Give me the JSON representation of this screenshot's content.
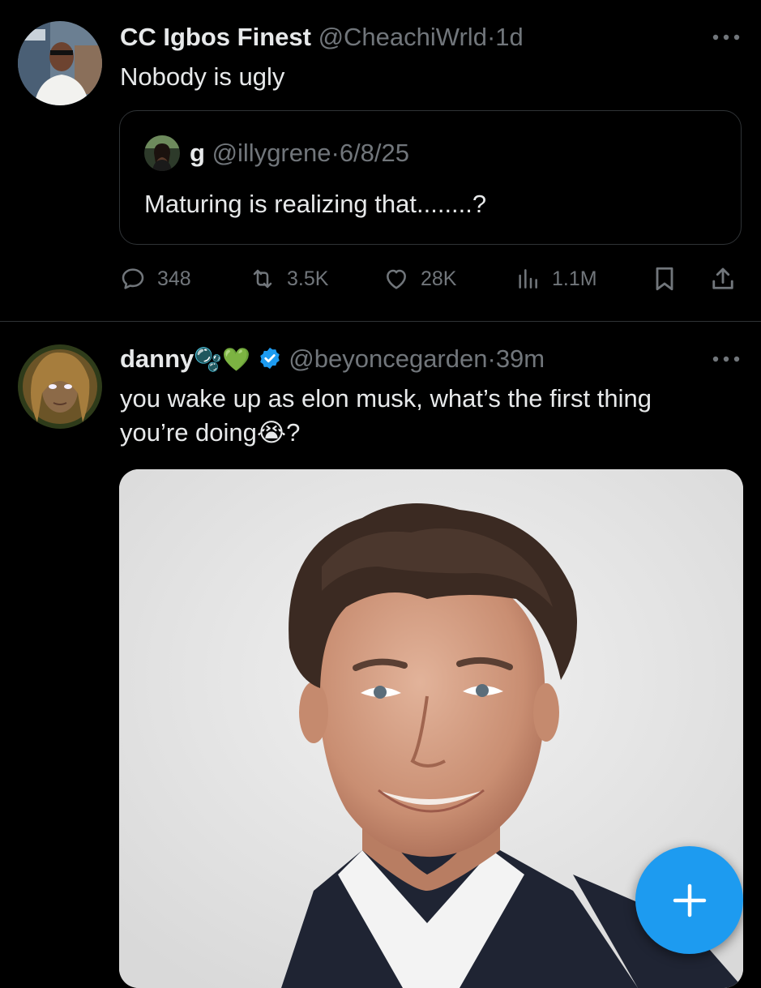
{
  "tweets": [
    {
      "display_name": "CC Igbos Finest",
      "handle": "@CheachiWrld",
      "separator": "·",
      "time": "1d",
      "text": "Nobody is ugly",
      "quoted": {
        "display_name": "g",
        "handle": "@illygrene",
        "separator": "·",
        "time": "6/8/25",
        "text": "Maturing is realizing that........?"
      },
      "stats": {
        "replies": "348",
        "reposts": "3.5K",
        "likes": "28K",
        "views": "1.1M"
      }
    },
    {
      "display_name": "danny",
      "name_emoji": "🫧💚",
      "verified": true,
      "handle": "@beyoncegarden",
      "separator": "·",
      "time": "39m",
      "text_line1": "you wake up as elon musk, what’s the first thing",
      "text_line2": "you’re doing😭?"
    }
  ],
  "icons": [
    "more-icon",
    "reply-icon",
    "repost-icon",
    "like-icon",
    "views-icon",
    "bookmark-icon",
    "share-icon",
    "verified-badge-icon",
    "compose-plus-icon"
  ],
  "colors": {
    "background": "#000000",
    "text": "#e7e9ea",
    "muted": "#71767b",
    "border": "#2f3336",
    "accent": "#1d9bf0",
    "heart_emoji": "#2ecc40"
  }
}
